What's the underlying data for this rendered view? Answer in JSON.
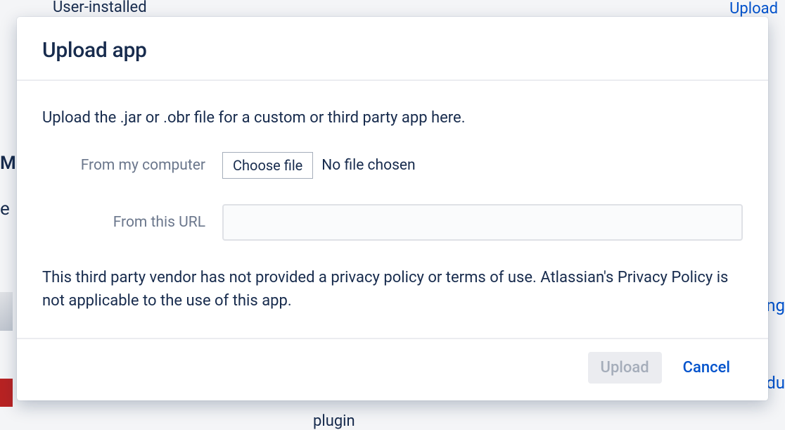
{
  "backdrop": {
    "dropdown_text": "User-installed",
    "upload_link": "Upload",
    "letter_m": "M",
    "letter_e": "e",
    "ng": "ng",
    "du": "du",
    "plugin": "plugin"
  },
  "modal": {
    "title": "Upload app",
    "instruction": "Upload the .jar or .obr file for a custom or third party app here.",
    "from_computer_label": "From my computer",
    "choose_file_label": "Choose file",
    "file_status": "No file chosen",
    "from_url_label": "From this URL",
    "url_value": "",
    "disclaimer": "This third party vendor has not provided a privacy policy or terms of use. Atlassian's Privacy Policy is not applicable to the use of this app.",
    "upload_button": "Upload",
    "cancel_button": "Cancel"
  }
}
